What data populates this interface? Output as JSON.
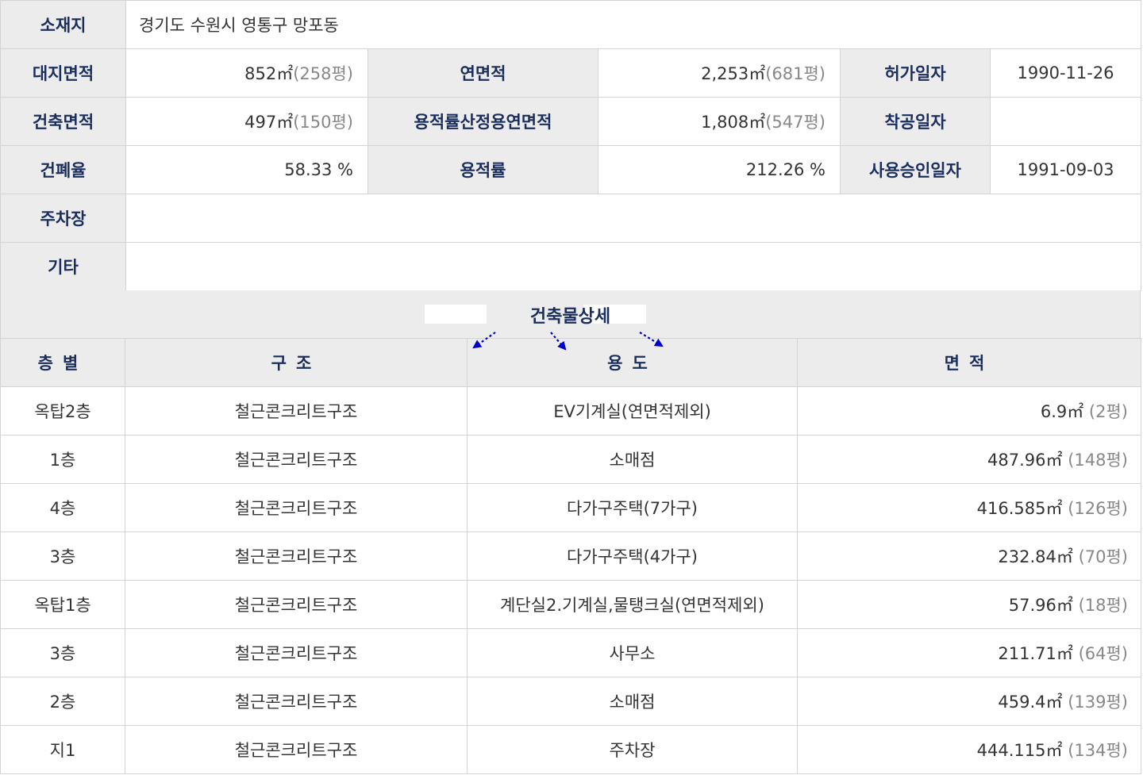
{
  "info": {
    "location_label": "소재지",
    "location_value": "경기도 수원시 영통구 망포동",
    "land_area_label": "대지면적",
    "land_area_value": "852㎡",
    "land_area_pyeong": "(258평)",
    "total_floor_area_label": "연면적",
    "total_floor_area_value": "2,253㎡",
    "total_floor_area_pyeong": "(681평)",
    "permit_date_label": "허가일자",
    "permit_date_value": "1990-11-26",
    "building_area_label": "건축면적",
    "building_area_value": "497㎡",
    "building_area_pyeong": "(150평)",
    "far_floor_area_label": "용적률산정용연면적",
    "far_floor_area_value": "1,808㎡",
    "far_floor_area_pyeong": "(547평)",
    "start_date_label": "착공일자",
    "start_date_value": "",
    "coverage_label": "건폐율",
    "coverage_value": "58.33 %",
    "far_label": "용적률",
    "far_value": "212.26 %",
    "approval_date_label": "사용승인일자",
    "approval_date_value": "1991-09-03",
    "parking_label": "주차장",
    "parking_value": "",
    "etc_label": "기타",
    "etc_value": ""
  },
  "detail": {
    "section_title": "건축물상세",
    "headers": {
      "floor": "층별",
      "structure": "구조",
      "usage": "용도",
      "area": "면적"
    },
    "rows": [
      {
        "floor": "옥탑2층",
        "structure": "철근콘크리트구조",
        "usage": "EV기계실(연면적제외)",
        "area": "6.9㎡",
        "pyeong": "(2평)"
      },
      {
        "floor": "1층",
        "structure": "철근콘크리트구조",
        "usage": "소매점",
        "area": "487.96㎡",
        "pyeong": "(148평)"
      },
      {
        "floor": "4층",
        "structure": "철근콘크리트구조",
        "usage": "다가구주택(7가구)",
        "area": "416.585㎡",
        "pyeong": "(126평)"
      },
      {
        "floor": "3층",
        "structure": "철근콘크리트구조",
        "usage": "다가구주택(4가구)",
        "area": "232.84㎡",
        "pyeong": "(70평)"
      },
      {
        "floor": "옥탑1층",
        "structure": "철근콘크리트구조",
        "usage": "계단실2.기계실,물탱크실(연면적제외)",
        "area": "57.96㎡",
        "pyeong": "(18평)"
      },
      {
        "floor": "3층",
        "structure": "철근콘크리트구조",
        "usage": "사무소",
        "area": "211.71㎡",
        "pyeong": "(64평)"
      },
      {
        "floor": "2층",
        "structure": "철근콘크리트구조",
        "usage": "소매점",
        "area": "459.4㎡",
        "pyeong": "(139평)"
      },
      {
        "floor": "지1",
        "structure": "철근콘크리트구조",
        "usage": "주차장",
        "area": "444.115㎡",
        "pyeong": "(134평)"
      }
    ]
  },
  "colors": {
    "label_text": "#1a2e5e",
    "label_bg": "#ececec",
    "border": "#d4d4d4",
    "arrow": "#0000cc",
    "sub_text": "#888888"
  }
}
